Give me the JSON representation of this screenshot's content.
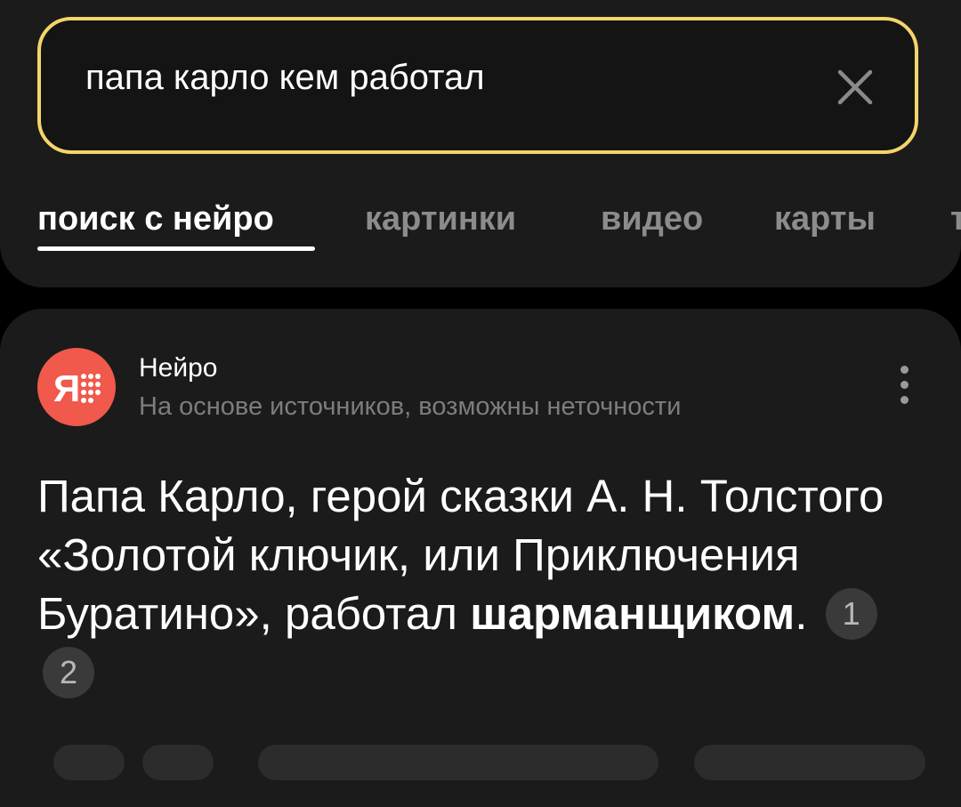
{
  "search": {
    "query": "папа карло кем работал"
  },
  "tabs": [
    {
      "label": "поиск с нейро",
      "active": true
    },
    {
      "label": "картинки"
    },
    {
      "label": "видео"
    },
    {
      "label": "карты"
    },
    {
      "label": "т"
    }
  ],
  "answer_card": {
    "source_name": "Нейро",
    "source_disclaimer": "На основе источников, возможны неточности",
    "answer_text": "Папа Карло, герой сказки А. Н. Толстого «Золотой ключик, или Приключения Буратино», работал ",
    "answer_bold": "шарманщиком",
    "answer_end": ".",
    "references": [
      "1",
      "2"
    ]
  },
  "colors": {
    "accent_border": "#f4d56a",
    "logo_bg": "#f0594b"
  },
  "icons": {
    "clear": "close-icon",
    "more": "more-vertical-icon",
    "logo": "neuro-logo-icon"
  }
}
